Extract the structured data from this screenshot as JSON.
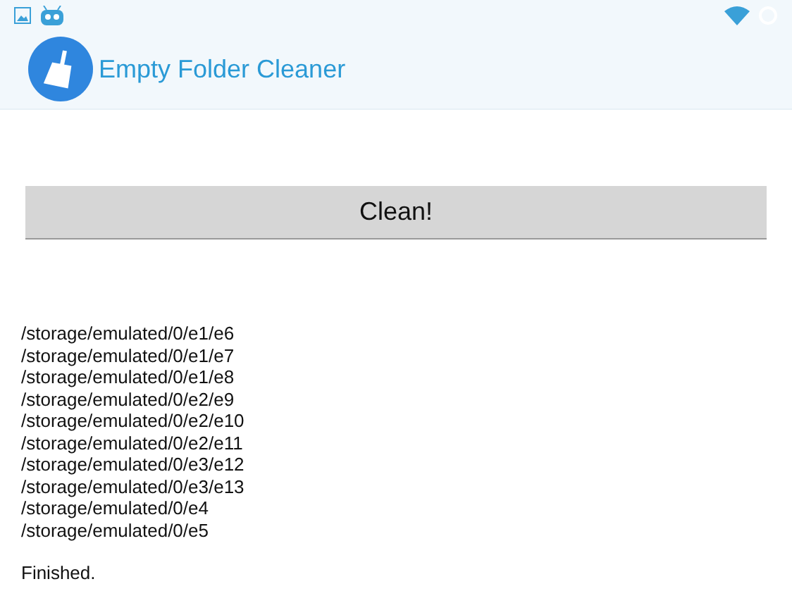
{
  "app_bar": {
    "title": "Empty Folder Cleaner"
  },
  "clean_button": {
    "label": "Clean!"
  },
  "removed_paths": [
    "/storage/emulated/0/e1/e6",
    "/storage/emulated/0/e1/e7",
    "/storage/emulated/0/e1/e8",
    "/storage/emulated/0/e2/e9",
    "/storage/emulated/0/e2/e10",
    "/storage/emulated/0/e2/e11",
    "/storage/emulated/0/e3/e12",
    "/storage/emulated/0/e3/e13",
    "/storage/emulated/0/e4",
    "/storage/emulated/0/e5"
  ],
  "status_message": "Finished."
}
